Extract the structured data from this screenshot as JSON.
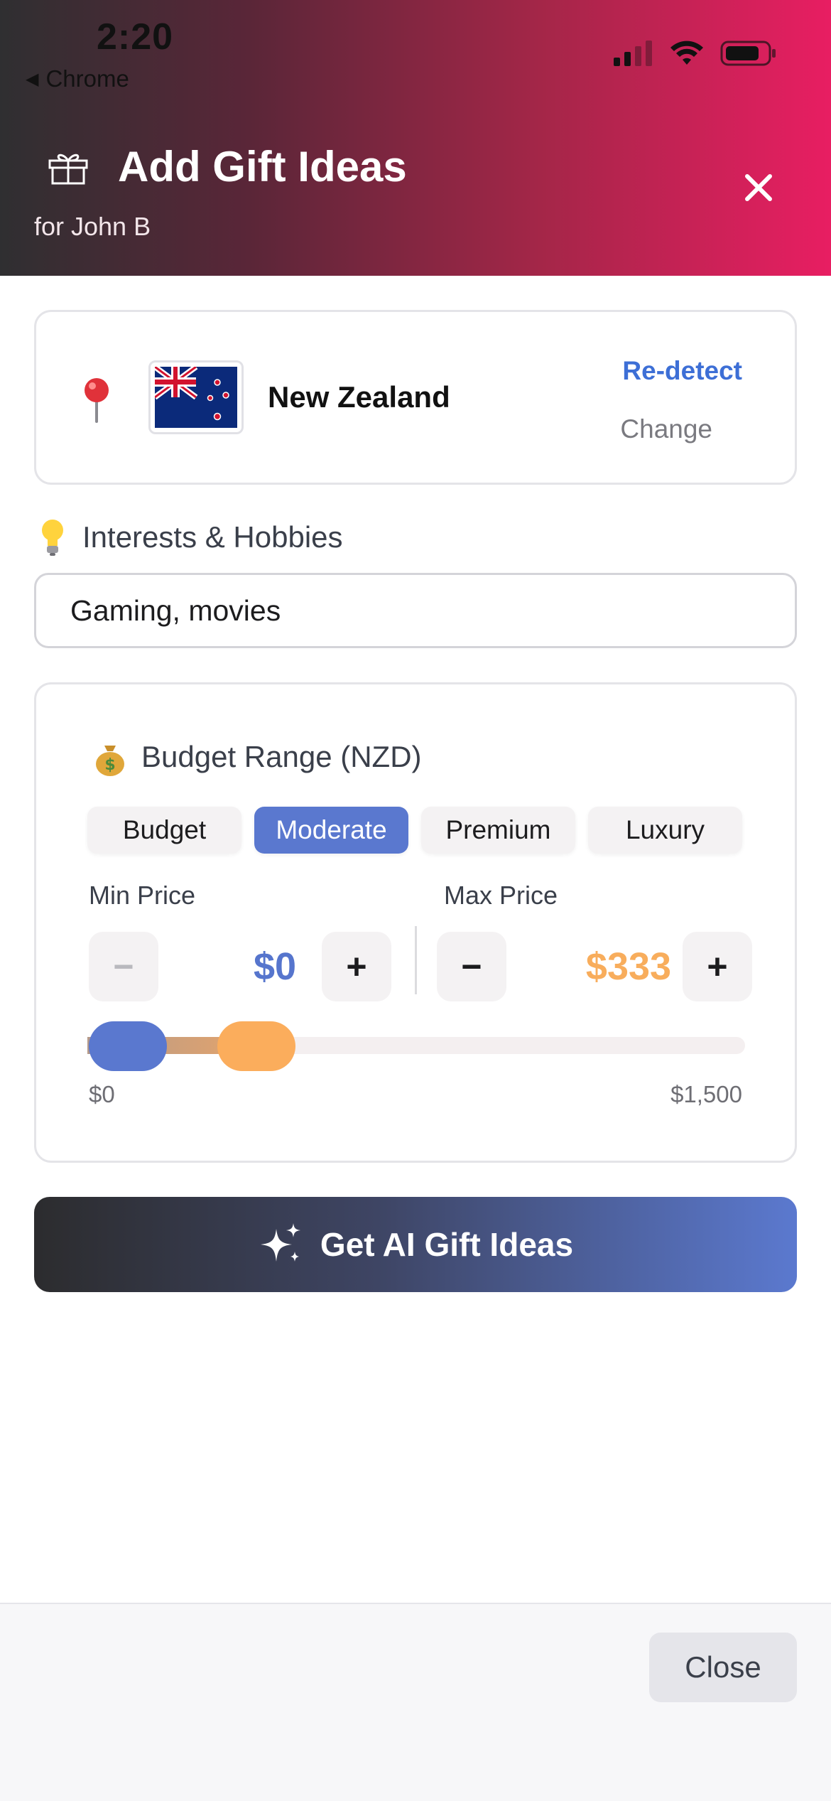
{
  "status_bar": {
    "time": "2:20",
    "back_app": "Chrome"
  },
  "header": {
    "title": "Add Gift Ideas",
    "subtitle": "for John B"
  },
  "location": {
    "country": "New Zealand",
    "redetect_label": "Re-detect",
    "change_label": "Change"
  },
  "interests": {
    "label": "Interests & Hobbies",
    "value": "Gaming, movies"
  },
  "budget": {
    "label": "Budget Range (NZD)",
    "tiers": [
      "Budget",
      "Moderate",
      "Premium",
      "Luxury"
    ],
    "selected_tier": "Moderate",
    "min_label": "Min Price",
    "max_label": "Max Price",
    "min_value": "$0",
    "max_value": "$333",
    "range_min_label": "$0",
    "range_max_label": "$1,500",
    "minus_symbol": "−",
    "plus_symbol": "+"
  },
  "cta": {
    "label": "Get AI Gift Ideas"
  },
  "footer": {
    "close_label": "Close"
  },
  "colors": {
    "accent_blue": "#5a78cf",
    "accent_orange": "#f8ad5c",
    "header_pink": "#e81e62"
  }
}
